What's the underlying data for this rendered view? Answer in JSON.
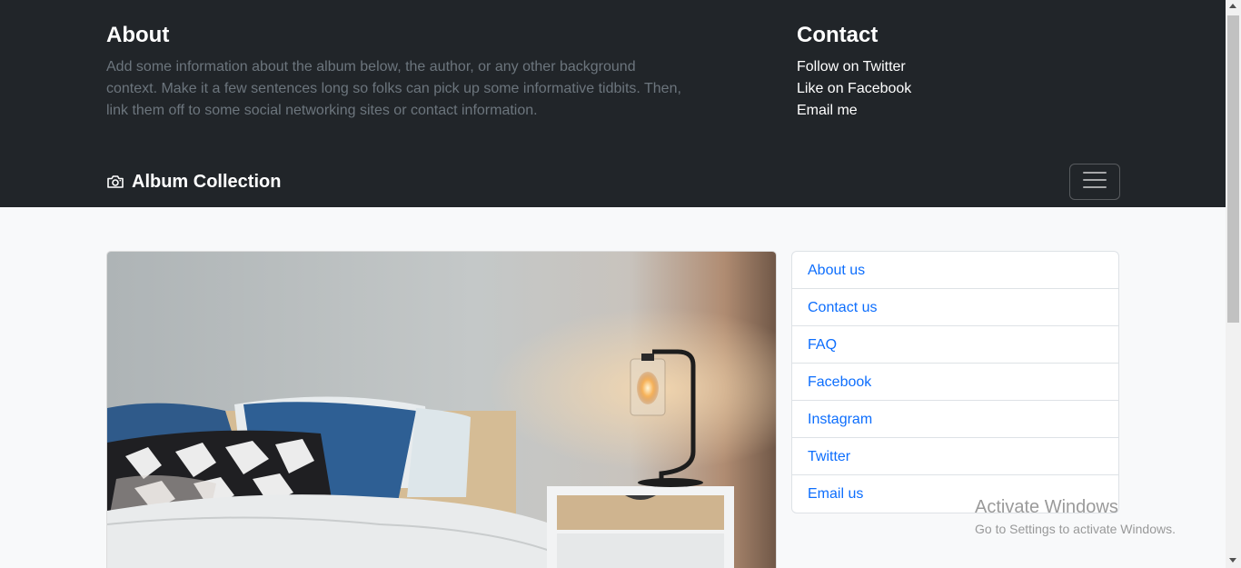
{
  "header": {
    "about": {
      "title": "About",
      "text": "Add some information about the album below, the author, or any other background context. Make it a few sentences long so folks can pick up some informative tidbits. Then, link them off to some social networking sites or contact information."
    },
    "contact": {
      "title": "Contact",
      "links": [
        "Follow on Twitter",
        "Like on Facebook",
        "Email me"
      ]
    }
  },
  "navbar": {
    "brand": "Album Collection",
    "brand_icon": "camera-icon",
    "toggler_icon": "hamburger-menu-icon"
  },
  "sidebar": {
    "links": [
      "About us",
      "Contact us",
      "FAQ",
      "Facebook",
      "Instagram",
      "Twitter",
      "Email us"
    ]
  },
  "watermark": {
    "title": "Activate Windows",
    "subtitle": "Go to Settings to activate Windows."
  },
  "colors": {
    "header_bg": "#212529",
    "muted_text": "#6c757d",
    "link": "#0d6efd",
    "page_bg": "#f8f9fa"
  }
}
